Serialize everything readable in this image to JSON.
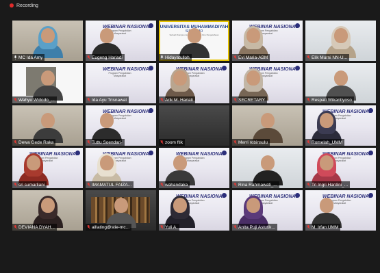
{
  "recording": {
    "label": "Recording"
  },
  "slide": {
    "title": "WEBINAR NASIONAL",
    "subtitle": "Program Pengabdian Masyarakat"
  },
  "university": {
    "line1": "UNIVERSITAS MUHAMMADIYAH",
    "line2": "SIDOARJO",
    "line3": "Sebuah Kampus dengan Unggulan Ilmu Pengetahuan"
  },
  "participants": [
    {
      "name": "MC Ida Amy",
      "bg": "room",
      "hijab": "#5aa0c8",
      "body": "#3e7faa",
      "mic": "on"
    },
    {
      "name": "Eugeng Hariadi",
      "bg": "slide",
      "hijab": "",
      "body": "#2b2b2b",
      "mic": "off"
    },
    {
      "name": "Hidayatulloh",
      "bg": "uni",
      "hijab": "",
      "body": "#333",
      "mic": "on",
      "active": true
    },
    {
      "name": "Evi Maria-ABM",
      "bg": "slide",
      "hijab": "#c7b9a5",
      "body": "#8a7560",
      "mic": "off"
    },
    {
      "name": "Elik Murni NN-U...",
      "bg": "light",
      "hijab": "#d6c9b8",
      "body": "#b5a38a",
      "mic": "off"
    },
    {
      "name": "Wahyu Widodo_...",
      "bg": "white",
      "hijab": "",
      "body": "#444",
      "mic": "off",
      "photo": true
    },
    {
      "name": "Ida Ayu Trisnawat",
      "bg": "slide",
      "hijab": "",
      "body": "",
      "mic": "off"
    },
    {
      "name": "Arik M. Hariati",
      "bg": "slide",
      "hijab": "#b9a58f",
      "body": "#6e5a4a",
      "mic": "off"
    },
    {
      "name": "SECRETARY",
      "bg": "slide",
      "hijab": "#c2b6a6",
      "body": "#776655",
      "mic": "off"
    },
    {
      "name": "Respati Wikantiyoso",
      "bg": "light",
      "hijab": "",
      "body": "#505050",
      "mic": "off"
    },
    {
      "name": "Dewa Gede Raka",
      "bg": "room",
      "hijab": "",
      "body": "#3c3c3c",
      "mic": "off"
    },
    {
      "name": "Tuttu Soendari-",
      "bg": "slide",
      "hijab": "",
      "body": "#2c2c2c",
      "mic": "off"
    },
    {
      "name": "zoom ftik",
      "bg": "dark",
      "hijab": "",
      "body": "",
      "mic": "off"
    },
    {
      "name": "Merri robinsulu",
      "bg": "room",
      "hijab": "",
      "body": "#5b4a3a",
      "mic": "off"
    },
    {
      "name": "Romelah_UMM",
      "bg": "slide",
      "hijab": "#3b3b52",
      "body": "#2b2b3a",
      "mic": "off"
    },
    {
      "name": "sri sumarliani",
      "bg": "slide",
      "hijab": "#a83a2e",
      "body": "#8c2a22",
      "mic": "off"
    },
    {
      "name": "IMAMATUL FAIZA...",
      "bg": "slide",
      "hijab": "#e8e0d0",
      "body": "#c8bba5",
      "mic": "off"
    },
    {
      "name": "wahandaka",
      "bg": "slide",
      "hijab": "",
      "body": "#3a3a3a",
      "mic": "off"
    },
    {
      "name": "Rina Rahmawati_...",
      "bg": "light",
      "hijab": "",
      "body": "#222",
      "mic": "off"
    },
    {
      "name": "Tri Ingri Hardini_...",
      "bg": "slide",
      "hijab": "#d04a5a",
      "body": "#a63848",
      "mic": "off"
    },
    {
      "name": "DEVIANA DYAH...",
      "bg": "room",
      "hijab": "#3a2a2a",
      "body": "#2b2020",
      "mic": "off"
    },
    {
      "name": "aillating@stie-mc...",
      "bg": "dark",
      "hijab": "",
      "body": "#555",
      "mic": "off",
      "shelf": true
    },
    {
      "name": "Yuli A.",
      "bg": "slide",
      "hijab": "#2e2a35",
      "body": "#22202a",
      "mic": "off"
    },
    {
      "name": "Anita Puji Astutik...",
      "bg": "slide",
      "hijab": "#5b3a7a",
      "body": "#4a2e66",
      "mic": "off"
    },
    {
      "name": "M. Irfan UMM",
      "bg": "slide",
      "hijab": "",
      "body": "#333",
      "mic": "off"
    }
  ]
}
